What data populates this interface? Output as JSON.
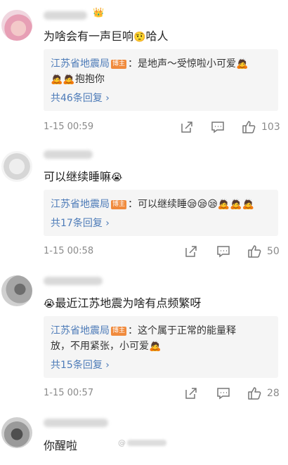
{
  "comments": [
    {
      "text": "为啥会有一声巨响",
      "text_suffix": "哈人",
      "text_emoji": "🤨",
      "reply": {
        "author": "江苏省地震局",
        "badge": "博主",
        "text": "：是地声～受惊啦小可爱",
        "text_emoji": "🙇",
        "line2_emoji": "🙇🙇",
        "line2": "抱抱你",
        "count_label": "共46条回复 ›"
      },
      "timestamp": "1-15 00:59",
      "likes": "103"
    },
    {
      "text": "可以继续睡嘛",
      "text_emoji": "😭",
      "reply": {
        "author": "江苏省地震局",
        "badge": "博主",
        "text": "：可以继续睡",
        "text_emoji": "😪😪😪🙇🙇🙇",
        "count_label": "共17条回复 ›"
      },
      "timestamp": "1-15 00:58",
      "likes": "50"
    },
    {
      "text": "最近江苏地震为啥有点频繁呀",
      "text_prefix_emoji": "😭",
      "reply": {
        "author": "江苏省地震局",
        "badge": "博主",
        "text": "：这个属于正常的能量释",
        "line2": "放，不用紧张，小可爱",
        "line2_emoji": "🙇",
        "count_label": "共15条回复 ›"
      },
      "timestamp": "1-15 00:57",
      "likes": "28"
    },
    {
      "text": "你醒啦"
    }
  ],
  "icons": {
    "share": "share-icon",
    "comment": "comment-icon",
    "like": "thumbs-up-icon",
    "crown": "crown-icon"
  },
  "colors": {
    "link": "#4d7bb8",
    "badge": "#f08a3c",
    "meta": "#8a8a8a",
    "reply_bg": "#f5f5f5"
  },
  "watermark": {
    "prefix": "@"
  }
}
